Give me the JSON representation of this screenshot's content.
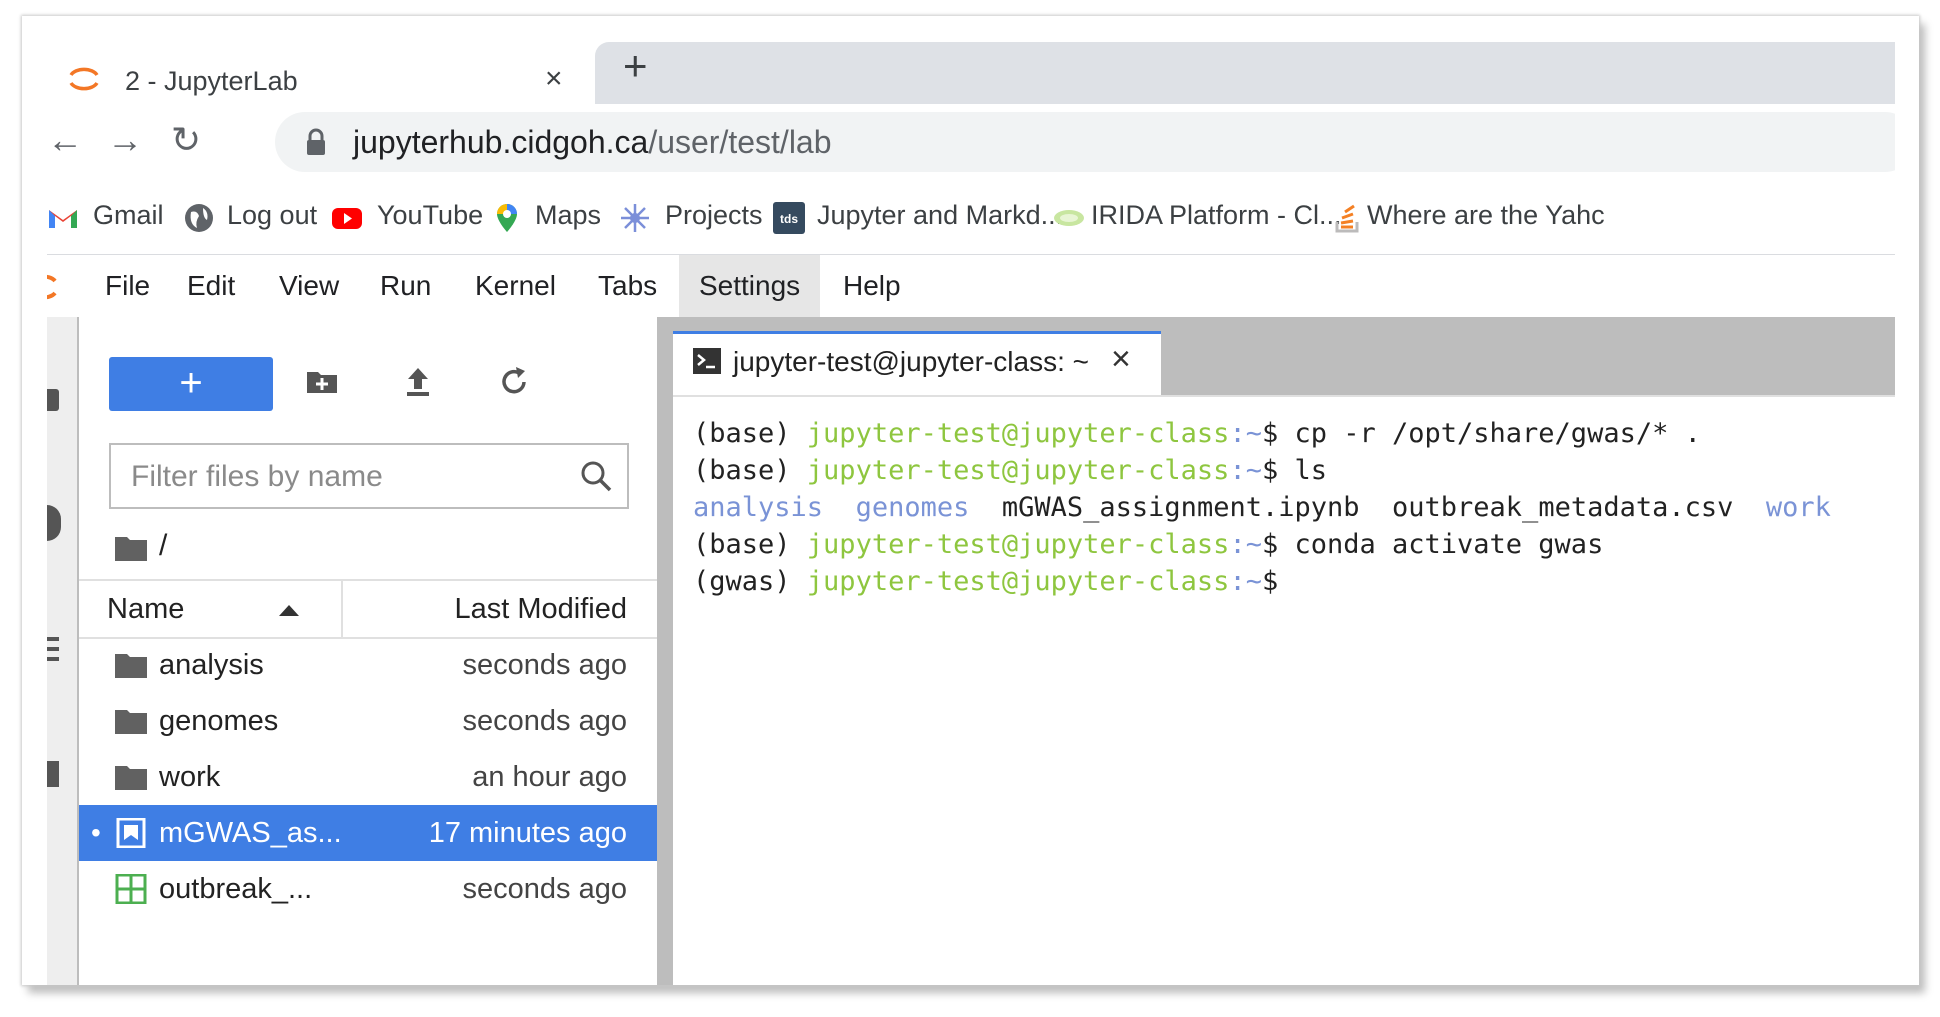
{
  "browser": {
    "tab_title": "2 - JupyterLab",
    "close_glyph": "×",
    "new_tab_glyph": "+",
    "url_host": "jupyterhub.cidgoh.ca",
    "url_path": "/user/test/lab",
    "nav": {
      "back": "←",
      "forward": "→",
      "reload": "↻"
    }
  },
  "bookmarks": [
    {
      "label": "Gmail",
      "icon": "gmail-icon"
    },
    {
      "label": "Log out",
      "icon": "globe-icon"
    },
    {
      "label": "YouTube",
      "icon": "youtube-icon"
    },
    {
      "label": "Maps",
      "icon": "maps-icon"
    },
    {
      "label": "Projects",
      "icon": "projects-icon"
    },
    {
      "label": "Jupyter and Markd...",
      "icon": "tds-icon"
    },
    {
      "label": "IRIDA Platform - Cl...",
      "icon": "irida-icon"
    },
    {
      "label": "Where are the Yahc",
      "icon": "stackoverflow-icon"
    }
  ],
  "menu": [
    "File",
    "Edit",
    "View",
    "Run",
    "Kernel",
    "Tabs",
    "Settings",
    "Help"
  ],
  "menu_active": "Settings",
  "filebrowser": {
    "new_label": "+",
    "filter_placeholder": "Filter files by name",
    "breadcrumb": "/",
    "col_name": "Name",
    "col_modified": "Last Modified",
    "rows": [
      {
        "name": "analysis",
        "modified": "seconds ago",
        "type": "folder"
      },
      {
        "name": "genomes",
        "modified": "seconds ago",
        "type": "folder"
      },
      {
        "name": "work",
        "modified": "an hour ago",
        "type": "folder"
      },
      {
        "name": "mGWAS_as...",
        "modified": "17 minutes ago",
        "type": "notebook",
        "selected": true,
        "dot": "•"
      },
      {
        "name": "outbreak_...",
        "modified": "seconds ago",
        "type": "csv"
      }
    ]
  },
  "terminal": {
    "tab_label": "jupyter-test@jupyter-class: ~",
    "tab_close": "×",
    "host": "jupyter-test@jupyter-class",
    "lines": [
      {
        "env": "(base) ",
        "prompt_end": "$ ",
        "cmd": "cp -r /opt/share/gwas/* ."
      },
      {
        "env": "(base) ",
        "prompt_end": "$ ",
        "cmd": "ls"
      },
      {
        "env": "(base) ",
        "prompt_end": "$ ",
        "cmd": "conda activate gwas"
      },
      {
        "env": "(gwas) ",
        "prompt_end": "$",
        "cmd": ""
      }
    ],
    "tilde": ":~",
    "ls_output": {
      "dirs": [
        "analysis",
        "genomes",
        "work"
      ],
      "files": [
        "mGWAS_assignment.ipynb",
        "outbreak_metadata.csv"
      ]
    }
  }
}
